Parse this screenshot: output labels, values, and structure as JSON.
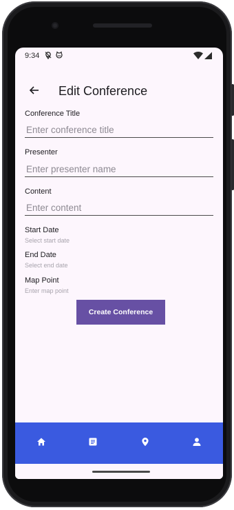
{
  "status_bar": {
    "time": "9:34",
    "icons": [
      "location-off-icon",
      "cat-notification-icon",
      "wifi-icon",
      "cellular-icon"
    ]
  },
  "app_bar": {
    "back_icon": "arrow-back-icon",
    "title": "Edit Conference"
  },
  "form": {
    "conference_title": {
      "label": "Conference Title",
      "placeholder": "Enter conference title",
      "value": ""
    },
    "presenter": {
      "label": "Presenter",
      "placeholder": "Enter presenter name",
      "value": ""
    },
    "content": {
      "label": "Content",
      "placeholder": "Enter content",
      "value": ""
    },
    "start_date": {
      "label": "Start Date",
      "hint": "Select start date"
    },
    "end_date": {
      "label": "End Date",
      "hint": "Select end date"
    },
    "map_point": {
      "label": "Map Point",
      "hint": "Enter map point"
    },
    "submit_label": "Create Conference"
  },
  "bottom_nav": {
    "items": [
      {
        "icon": "home-icon"
      },
      {
        "icon": "article-icon"
      },
      {
        "icon": "location-pin-icon"
      },
      {
        "icon": "person-icon"
      }
    ]
  },
  "colors": {
    "screen_background": "#fdf6fd",
    "primary_button": "#6750a4",
    "bottom_nav": "#3a5ae0",
    "placeholder_text": "#8e8a93",
    "hint_text": "#a8a4ad",
    "title_text": "#1c1b1f"
  }
}
